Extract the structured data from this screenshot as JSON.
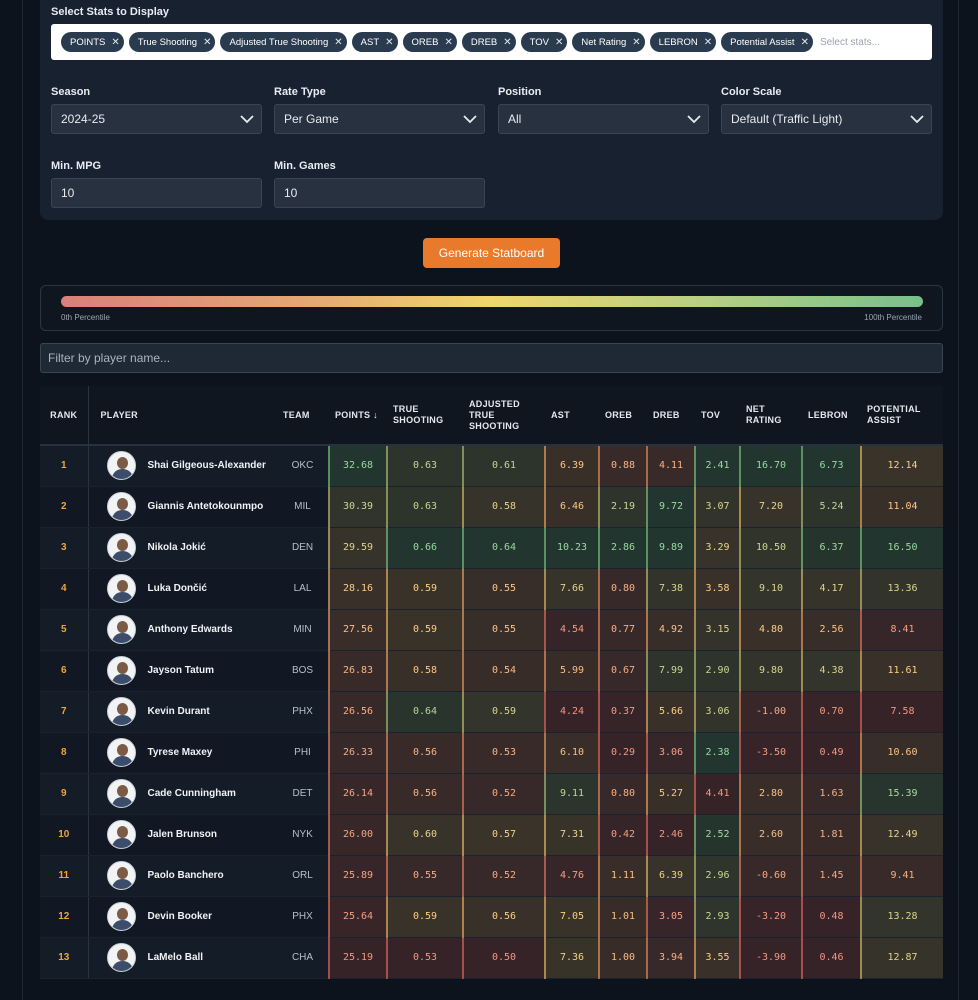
{
  "filters": {
    "stats_label": "Select Stats to Display",
    "chips": [
      "POINTS",
      "True Shooting",
      "Adjusted True Shooting",
      "AST",
      "OREB",
      "DREB",
      "TOV",
      "Net Rating",
      "LEBRON",
      "Potential Assist"
    ],
    "stats_placeholder": "Select stats...",
    "season_label": "Season",
    "season_value": "2024-25",
    "rate_label": "Rate Type",
    "rate_value": "Per Game",
    "position_label": "Position",
    "position_value": "All",
    "color_label": "Color Scale",
    "color_value": "Default (Traffic Light)",
    "mpg_label": "Min. MPG",
    "mpg_value": "10",
    "games_label": "Min. Games",
    "games_value": "10"
  },
  "generate_label": "Generate Statboard",
  "legend": {
    "low": "0th Percentile",
    "high": "100th Percentile"
  },
  "player_filter_placeholder": "Filter by player name...",
  "table": {
    "headers": {
      "rank": "RANK",
      "player": "PLAYER",
      "team": "TEAM",
      "points": "POINTS ↓",
      "ts": "TRUE SHOOTING",
      "ats": "ADJUSTED TRUE SHOOTING",
      "ast": "AST",
      "oreb": "OREB",
      "dreb": "DREB",
      "tov": "TOV",
      "net": "NET RATING",
      "lebron": "LEBRON",
      "pa": "POTENTIAL ASSIST"
    },
    "rows": [
      {
        "rank": "1",
        "player": "Shai Gilgeous-Alexander",
        "team": "OKC",
        "pts": "32.68",
        "ts": "0.63",
        "ats": "0.61",
        "ast": "6.39",
        "oreb": "0.88",
        "dreb": "4.11",
        "tov": "2.41",
        "net": "16.70",
        "lebron": "6.73",
        "pa": "12.14"
      },
      {
        "rank": "2",
        "player": "Giannis Antetokounmpo",
        "team": "MIL",
        "pts": "30.39",
        "ts": "0.63",
        "ats": "0.58",
        "ast": "6.46",
        "oreb": "2.19",
        "dreb": "9.72",
        "tov": "3.07",
        "net": "7.20",
        "lebron": "5.24",
        "pa": "11.04"
      },
      {
        "rank": "3",
        "player": "Nikola Jokić",
        "team": "DEN",
        "pts": "29.59",
        "ts": "0.66",
        "ats": "0.64",
        "ast": "10.23",
        "oreb": "2.86",
        "dreb": "9.89",
        "tov": "3.29",
        "net": "10.50",
        "lebron": "6.37",
        "pa": "16.50"
      },
      {
        "rank": "4",
        "player": "Luka Dončić",
        "team": "LAL",
        "pts": "28.16",
        "ts": "0.59",
        "ats": "0.55",
        "ast": "7.66",
        "oreb": "0.80",
        "dreb": "7.38",
        "tov": "3.58",
        "net": "9.10",
        "lebron": "4.17",
        "pa": "13.36"
      },
      {
        "rank": "5",
        "player": "Anthony Edwards",
        "team": "MIN",
        "pts": "27.56",
        "ts": "0.59",
        "ats": "0.55",
        "ast": "4.54",
        "oreb": "0.77",
        "dreb": "4.92",
        "tov": "3.15",
        "net": "4.80",
        "lebron": "2.56",
        "pa": "8.41"
      },
      {
        "rank": "6",
        "player": "Jayson Tatum",
        "team": "BOS",
        "pts": "26.83",
        "ts": "0.58",
        "ats": "0.54",
        "ast": "5.99",
        "oreb": "0.67",
        "dreb": "7.99",
        "tov": "2.90",
        "net": "9.80",
        "lebron": "4.38",
        "pa": "11.61"
      },
      {
        "rank": "7",
        "player": "Kevin Durant",
        "team": "PHX",
        "pts": "26.56",
        "ts": "0.64",
        "ats": "0.59",
        "ast": "4.24",
        "oreb": "0.37",
        "dreb": "5.66",
        "tov": "3.06",
        "net": "-1.00",
        "lebron": "0.70",
        "pa": "7.58"
      },
      {
        "rank": "8",
        "player": "Tyrese Maxey",
        "team": "PHI",
        "pts": "26.33",
        "ts": "0.56",
        "ats": "0.53",
        "ast": "6.10",
        "oreb": "0.29",
        "dreb": "3.06",
        "tov": "2.38",
        "net": "-3.50",
        "lebron": "0.49",
        "pa": "10.60"
      },
      {
        "rank": "9",
        "player": "Cade Cunningham",
        "team": "DET",
        "pts": "26.14",
        "ts": "0.56",
        "ats": "0.52",
        "ast": "9.11",
        "oreb": "0.80",
        "dreb": "5.27",
        "tov": "4.41",
        "net": "2.80",
        "lebron": "1.63",
        "pa": "15.39"
      },
      {
        "rank": "10",
        "player": "Jalen Brunson",
        "team": "NYK",
        "pts": "26.00",
        "ts": "0.60",
        "ats": "0.57",
        "ast": "7.31",
        "oreb": "0.42",
        "dreb": "2.46",
        "tov": "2.52",
        "net": "2.60",
        "lebron": "1.81",
        "pa": "12.49"
      },
      {
        "rank": "11",
        "player": "Paolo Banchero",
        "team": "ORL",
        "pts": "25.89",
        "ts": "0.55",
        "ats": "0.52",
        "ast": "4.76",
        "oreb": "1.11",
        "dreb": "6.39",
        "tov": "2.96",
        "net": "-0.60",
        "lebron": "1.45",
        "pa": "9.41"
      },
      {
        "rank": "12",
        "player": "Devin Booker",
        "team": "PHX",
        "pts": "25.64",
        "ts": "0.59",
        "ats": "0.56",
        "ast": "7.05",
        "oreb": "1.01",
        "dreb": "3.05",
        "tov": "2.93",
        "net": "-3.20",
        "lebron": "0.48",
        "pa": "13.28"
      },
      {
        "rank": "13",
        "player": "LaMelo Ball",
        "team": "CHA",
        "pts": "25.19",
        "ts": "0.53",
        "ats": "0.50",
        "ast": "7.36",
        "oreb": "1.00",
        "dreb": "3.94",
        "tov": "3.55",
        "net": "-3.90",
        "lebron": "0.46",
        "pa": "12.87"
      }
    ]
  },
  "colors": {
    "page_bg": "#0d131c",
    "panel_bg": "#172130",
    "chip_bg": "#2a3b4f",
    "accent_button": "#e97a2c",
    "rank_text": "#f0a43c",
    "scale_low": "#d9807a",
    "scale_mid": "#efd66e",
    "scale_high": "#78c08a"
  }
}
